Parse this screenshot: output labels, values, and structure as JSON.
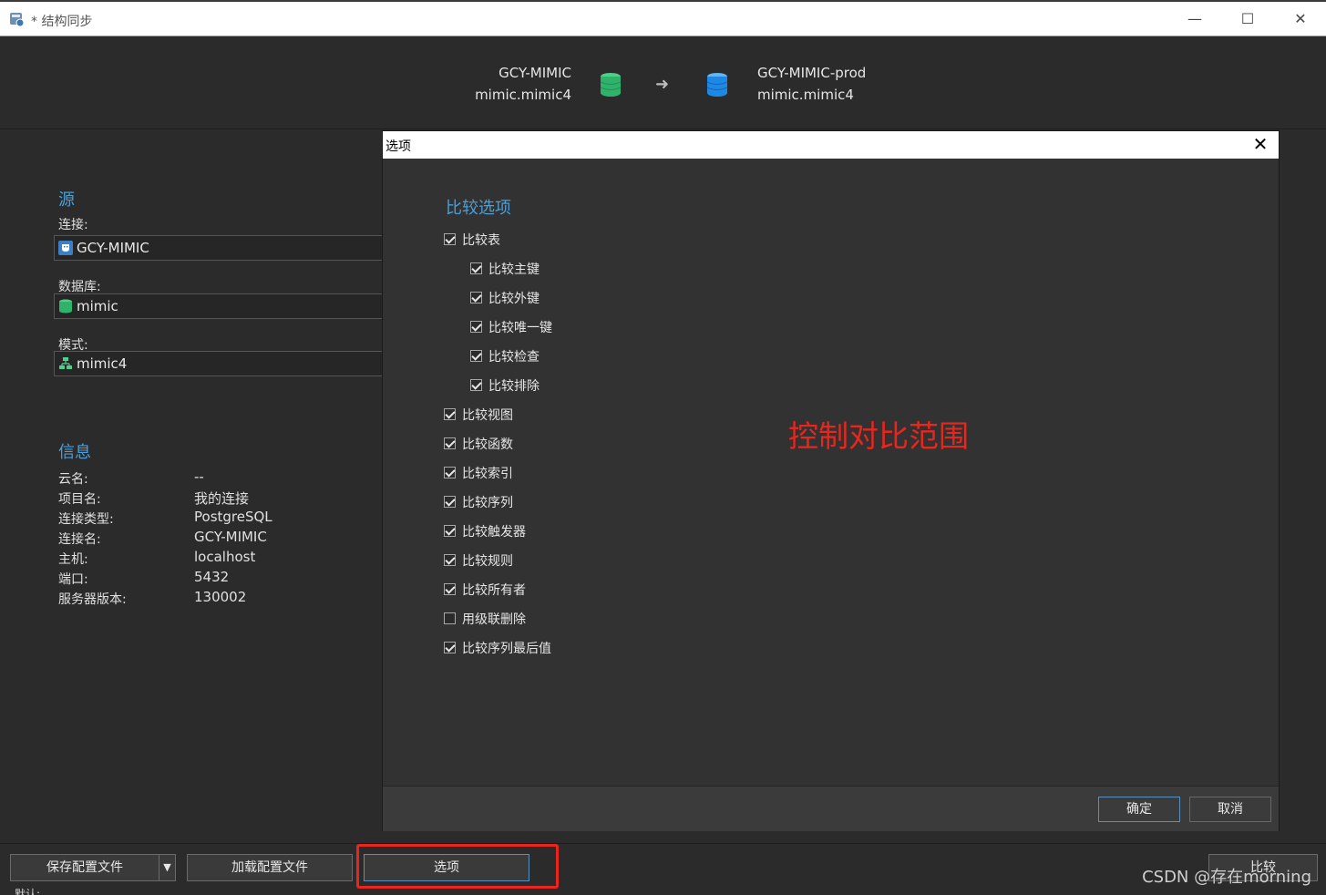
{
  "window": {
    "title": "* 结构同步",
    "minimize": "—",
    "maximize": "☐",
    "close": "✕"
  },
  "header": {
    "source": {
      "connection": "GCY-MIMIC",
      "schema": "mimic.mimic4",
      "db_color": "#2fb36b"
    },
    "target": {
      "connection": "GCY-MIMIC-prod",
      "schema": "mimic.mimic4",
      "db_color": "#1e88e5"
    },
    "arrow": "➜"
  },
  "source_panel": {
    "title": "源",
    "connection_label": "连接:",
    "connection_value": "GCY-MIMIC",
    "database_label": "数据库:",
    "database_value": "mimic",
    "schema_label": "模式:",
    "schema_value": "mimic4"
  },
  "info_panel": {
    "title": "信息",
    "rows": [
      {
        "key": "云名:",
        "value": "--"
      },
      {
        "key": "项目名:",
        "value": "我的连接"
      },
      {
        "key": "连接类型:",
        "value": "PostgreSQL"
      },
      {
        "key": "连接名:",
        "value": "GCY-MIMIC"
      },
      {
        "key": "主机:",
        "value": "localhost"
      },
      {
        "key": "端口:",
        "value": "5432"
      },
      {
        "key": "服务器版本:",
        "value": "130002"
      }
    ]
  },
  "dialog": {
    "title": "选项",
    "close": "✕",
    "section_title": "比较选项",
    "options": [
      {
        "label": "比较表",
        "checked": true,
        "indent": 0
      },
      {
        "label": "比较主键",
        "checked": true,
        "indent": 1
      },
      {
        "label": "比较外键",
        "checked": true,
        "indent": 1
      },
      {
        "label": "比较唯一键",
        "checked": true,
        "indent": 1
      },
      {
        "label": "比较检查",
        "checked": true,
        "indent": 1
      },
      {
        "label": "比较排除",
        "checked": true,
        "indent": 1
      },
      {
        "label": "比较视图",
        "checked": true,
        "indent": 0
      },
      {
        "label": "比较函数",
        "checked": true,
        "indent": 0
      },
      {
        "label": "比较索引",
        "checked": true,
        "indent": 0
      },
      {
        "label": "比较序列",
        "checked": true,
        "indent": 0
      },
      {
        "label": "比较触发器",
        "checked": true,
        "indent": 0
      },
      {
        "label": "比较规则",
        "checked": true,
        "indent": 0
      },
      {
        "label": "比较所有者",
        "checked": true,
        "indent": 0
      },
      {
        "label": "用级联删除",
        "checked": false,
        "indent": 0
      },
      {
        "label": "比较序列最后值",
        "checked": true,
        "indent": 0
      }
    ],
    "ok_label": "确定",
    "cancel_label": "取消"
  },
  "annotation": {
    "text": "控制对比范围",
    "color": "#e8261e"
  },
  "toolbar": {
    "save_profile": "保存配置文件",
    "dropdown": "▼",
    "load_profile": "加载配置文件",
    "options": "选项",
    "compare": "比较",
    "highlight_color": "#e8261e"
  },
  "watermark": "CSDN @存在morning",
  "footer_partial": "默认:"
}
